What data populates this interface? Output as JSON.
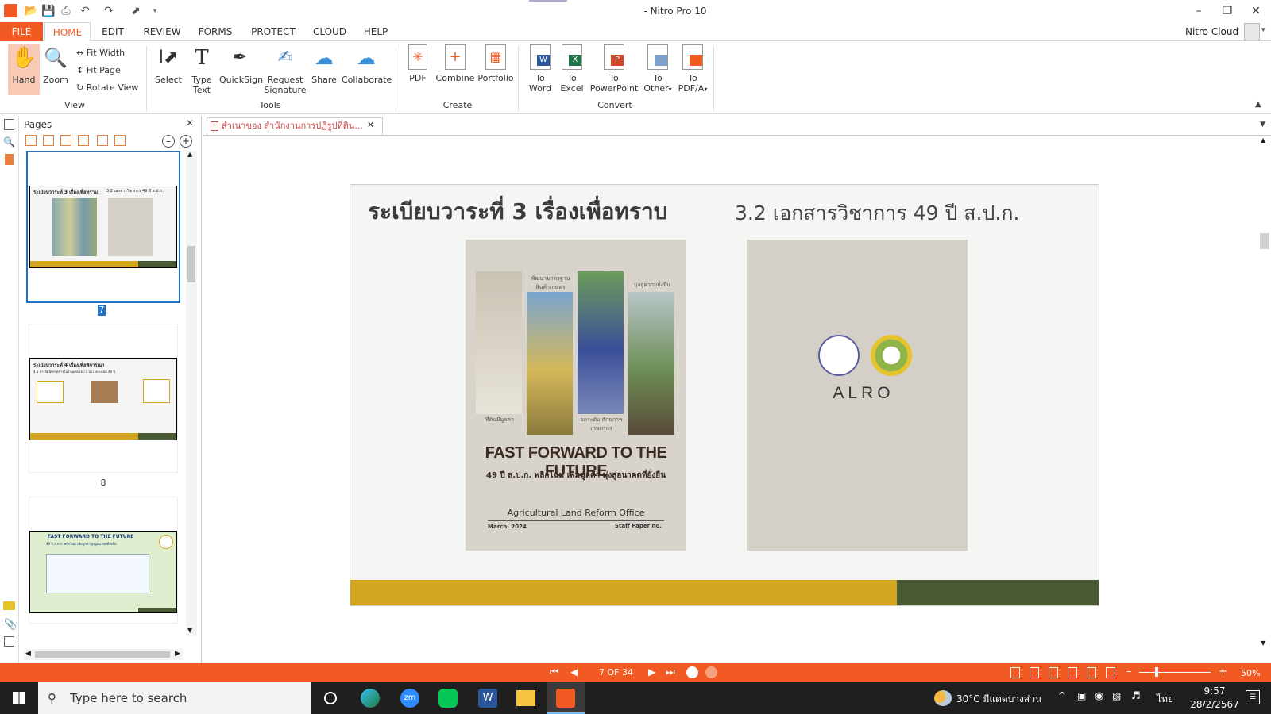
{
  "window": {
    "title": "- Nitro Pro 10"
  },
  "ribbon_tabs": [
    "FILE",
    "HOME",
    "EDIT",
    "REVIEW",
    "FORMS",
    "PROTECT",
    "CLOUD",
    "HELP"
  ],
  "account": {
    "label": "Nitro Cloud"
  },
  "view_group": {
    "label": "View",
    "hand": "Hand",
    "zoom": "Zoom",
    "fit_width": "Fit Width",
    "fit_page": "Fit Page",
    "rotate_view": "Rotate View"
  },
  "tools_group": {
    "label": "Tools",
    "select": "Select",
    "type_text_1": "Type",
    "type_text_2": "Text",
    "quicksign": "QuickSign",
    "request_sig_1": "Request",
    "request_sig_2": "Signature",
    "share": "Share",
    "collaborate": "Collaborate"
  },
  "create_group": {
    "label": "Create",
    "pdf": "PDF",
    "combine": "Combine",
    "portfolio": "Portfolio"
  },
  "convert_group": {
    "label": "Convert",
    "to": "To",
    "word": "Word",
    "excel": "Excel",
    "powerpoint": "PowerPoint",
    "other": "Other",
    "pdfa": "PDF/A"
  },
  "pages_panel": {
    "title": "Pages",
    "page_numbers": [
      "7",
      "8"
    ]
  },
  "thumbs": {
    "t1_title": "ระเบียบวาระที่ 3 เรื่องเพื่อทราบ",
    "t1_sub": "3.2 เอกสารวิชาการ 49 ปี ส.ป.ก.",
    "t2_title": "ระเบียบวาระที่ 4 เรื่องเพื่อพิจารณา",
    "t2_sub": "4.1 การจัดนิทรรศการในงานครบรอบ ส.ป.ก. ครบรอบ 49 ปี",
    "t3_title": "FAST FORWARD TO THE FUTURE",
    "t3_sub": "49 ปี ส.ป.ก. พลิกโฉม เพิ่มมูลค่า มุ่งสู่อนาคตที่ยั่งยืน"
  },
  "document": {
    "tab_label": "สำเนาของ สำนักงานการปฏิรูปที่ดิน...",
    "slide_title": "ระเบียบวาระที่ 3 เรื่องเพื่อทราบ",
    "slide_subtitle": "3.2 เอกสารวิชาการ 49 ปี ส.ป.ก.",
    "cover": {
      "strip_labels": [
        "พัฒนามาตรฐาน สินค้าเกษตร",
        "มุ่งสู่ความยั่งยืน",
        "ที่ดินมีมูลค่า",
        "ยกระดับ ศักยภาพเกษตรกร"
      ],
      "headline": "FAST FORWARD TO THE FUTURE",
      "thai_tagline": "49 ปี ส.ป.ก. พลิกโฉม เพิ่มมูลค่า มุ่งสู่อนาคตที่ยั่งยืน",
      "org": "Agricultural Land Reform Office",
      "date": "March, 2024",
      "paper": "Staff Paper no."
    },
    "logo_text": "ALRO"
  },
  "statusbar": {
    "page_indicator": "7 OF 34",
    "zoom": "50%"
  },
  "taskbar": {
    "search_placeholder": "Type here to search",
    "weather": "30°C  มีแดดบางส่วน",
    "lang": "ไทย",
    "time": "9:57",
    "date": "28/2/2567"
  },
  "colors": {
    "accent": "#f15a22",
    "gold": "#d4a520",
    "olive": "#4a5a35"
  }
}
